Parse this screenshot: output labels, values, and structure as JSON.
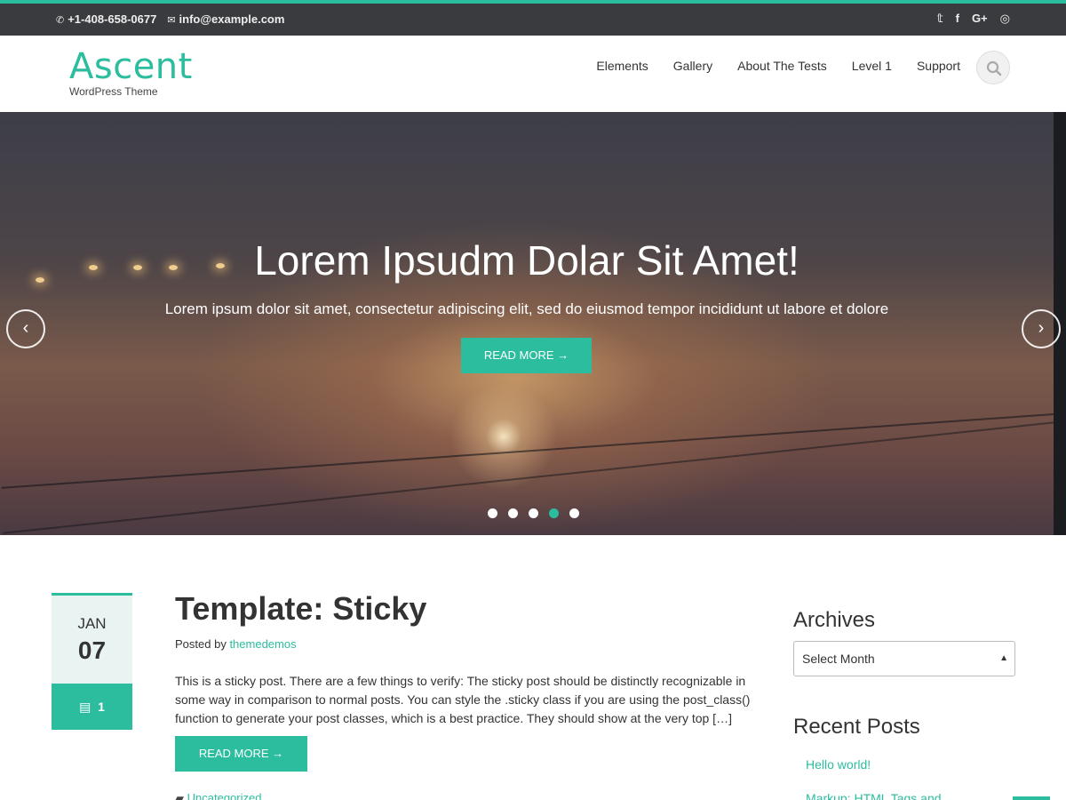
{
  "topbar": {
    "phone": "+1-408-658-0677",
    "email": "info@example.com",
    "social": [
      "twitter-icon",
      "facebook-icon",
      "google-plus-icon",
      "github-icon"
    ],
    "social_glyphs": [
      "𝕥",
      "f",
      "G+",
      "◎"
    ]
  },
  "site": {
    "name": "Ascent",
    "tagline": "WordPress Theme"
  },
  "nav": [
    "Elements",
    "Gallery",
    "About The Tests",
    "Level 1",
    "Support"
  ],
  "hero": {
    "title": "Lorem Ipsudm Dolar Sit Amet!",
    "subtitle": "Lorem ipsum dolor sit amet, consectetur adipiscing elit, sed do eiusmod tempor incididunt ut labore et dolore",
    "button": "READ MORE →",
    "prev": "‹",
    "next": "›",
    "active_slide": 4,
    "slide_count": 5
  },
  "post": {
    "month": "JAN",
    "day": "07",
    "comments": "1",
    "title": "Template: Sticky",
    "posted_by": "Posted by ",
    "author": "themedemos",
    "excerpt": "This is a sticky post. There are a few things to verify: The sticky post should be distinctly recognizable in some way in comparison to normal posts. You can style the .sticky class if you are using the post_class() function to generate your post classes, which is a best practice. They should show at the very top […]",
    "button": "READ MORE →",
    "category": "Uncategorized"
  },
  "sidebar": {
    "archives_title": "Archives",
    "select_value": "Select Month",
    "recent_title": "Recent Posts",
    "recent": [
      "Hello world!",
      "Markup: HTML Tags and"
    ]
  },
  "colors": {
    "accent": "#2bbd9e",
    "topbar": "#3a3b3e"
  }
}
